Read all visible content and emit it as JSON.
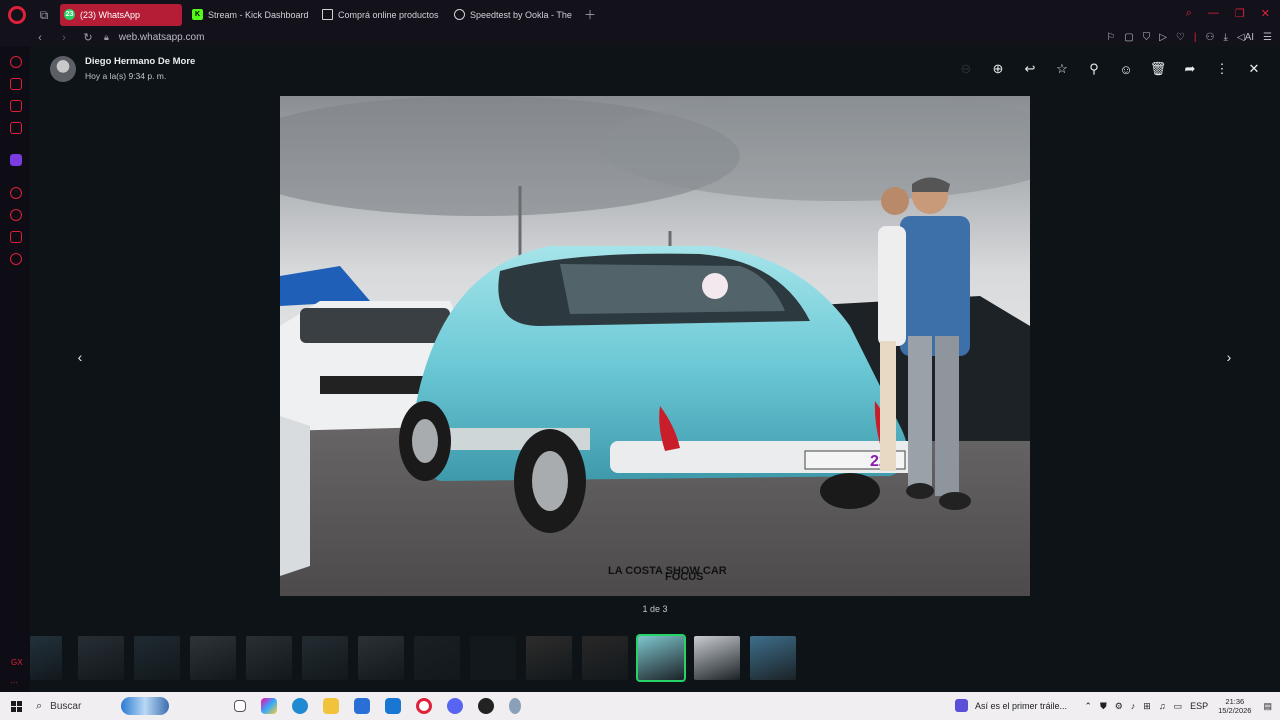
{
  "browser": {
    "tabs": [
      {
        "label": "(23) WhatsApp",
        "badge": "23",
        "active": true,
        "icon": "whatsapp-icon",
        "color": "#25d366"
      },
      {
        "label": "Stream - Kick Dashboard",
        "active": false,
        "icon": "kick-icon",
        "color": "#53fc18"
      },
      {
        "label": "Comprá online productos",
        "active": false,
        "icon": "page-icon",
        "color": "#cfd3d8"
      },
      {
        "label": "Speedtest by Ookla - The",
        "active": false,
        "icon": "speedtest-icon",
        "color": "#cfd3d8"
      }
    ],
    "url": "web.whatsapp.com",
    "ai_label": "AI",
    "accent": "#e0203a"
  },
  "viewer": {
    "sender_name": "Diego Hermano De More",
    "sender_time": "Hoy a la(s) 9:34 p. m.",
    "counter": "1 de 3",
    "selected_thumb": 11,
    "thumb_count": 14,
    "photo_logos": [
      "LA COSTA SHOW CAR",
      "FOCUS"
    ],
    "plate_number": "22"
  },
  "taskbar": {
    "search_placeholder": "Buscar",
    "media_title": "Así es el primer tráile...",
    "language": "ESP",
    "time": "21:36",
    "date": "15/2/2026"
  }
}
